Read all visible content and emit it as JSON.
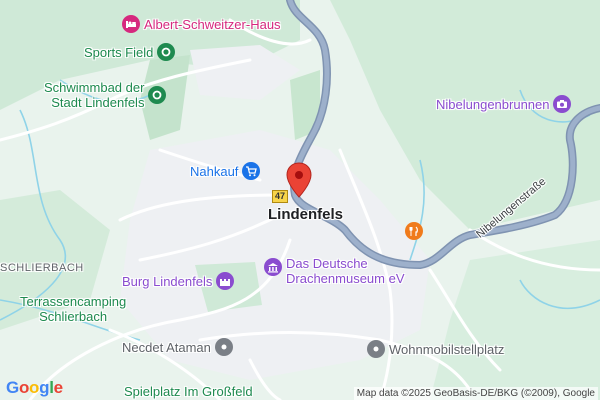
{
  "map": {
    "places": {
      "town": "Lindenfels",
      "village_west": "SCHLIERBACH"
    },
    "route_shield": "47",
    "road_name": "Nibelungenstraße",
    "pois": {
      "albert_schweitzer": "Albert-Schweitzer-Haus",
      "sports_field": "Sports Field",
      "schwimmbad_line1": "Schwimmbad der",
      "schwimmbad_line2": "Stadt Lindenfels",
      "nahkauf": "Nahkauf",
      "nibelungenbrunnen": "Nibelungenbrunnen",
      "burg": "Burg Lindenfels",
      "museum_line1": "Das Deutsche",
      "museum_line2": "Drachenmuseum eV",
      "terrassencamping_line1": "Terrassencamping",
      "terrassencamping_line2": "Schlierbach",
      "necdet": "Necdet Ataman",
      "wohnmobil": "Wohnmobilstellplatz",
      "spielplatz": "Spielplatz Im Großfeld"
    },
    "icons": {
      "albert_schweitzer": "hotel-icon",
      "sports_field": "park-icon",
      "schwimmbad": "park-icon",
      "nahkauf": "shopping-cart-icon",
      "nibelungenbrunnen": "camera-icon",
      "burg": "castle-icon",
      "museum": "museum-icon",
      "restaurant": "restaurant-icon",
      "necdet": "place-icon",
      "wohnmobil": "place-icon",
      "marker": "location-pin-icon"
    },
    "colors": {
      "forest": "#cfe9d7",
      "land": "#e9f3ed",
      "urban": "#eef0f3",
      "main_road": "#8fa3bf",
      "minor_road": "#ffffff",
      "stream": "#8fd3e8",
      "marker": "#ea4335",
      "poi_pink": "#d6287e",
      "poi_green": "#1e8a4f",
      "poi_blue": "#1a73e8",
      "poi_purple": "#8a4ccf",
      "poi_orange": "#f07b1b",
      "poi_gray": "#5f6368"
    }
  },
  "branding": {
    "logo": [
      "G",
      "o",
      "o",
      "g",
      "l",
      "e"
    ],
    "logo_colors": [
      "#4285f4",
      "#ea4335",
      "#fbbc05",
      "#4285f4",
      "#34a853",
      "#ea4335"
    ]
  },
  "attribution": "Map data ©2025 GeoBasis-DE/BKG (©2009), Google"
}
